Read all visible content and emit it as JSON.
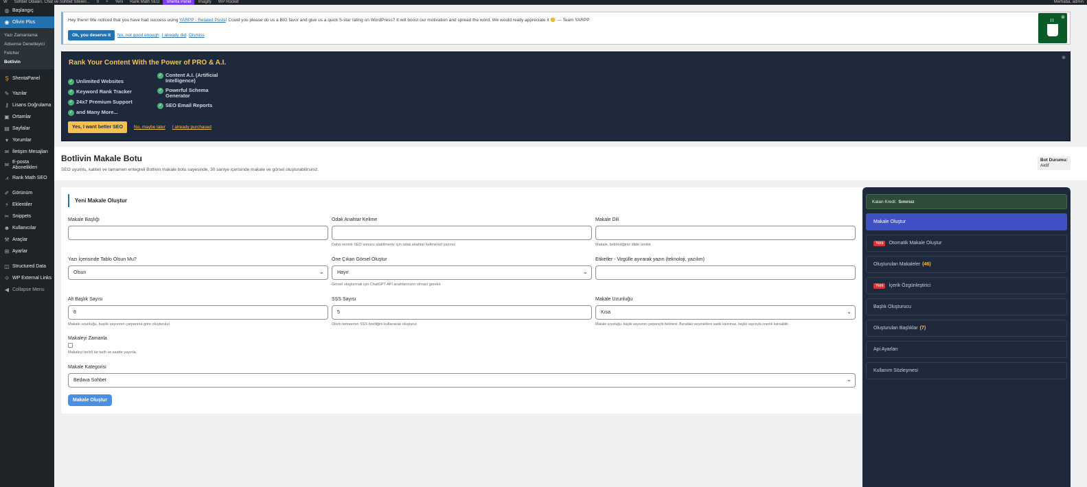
{
  "adminbar": {
    "items": [
      "W",
      "Sohbet Odaları, Chat ve Sohbet Siteleri...",
      "0",
      "+",
      "Yeni",
      "Rank Math SEO",
      "Shenta Panel",
      "Imagify",
      "WP Rocket"
    ],
    "active_index": 6,
    "user": "Merhaba, admin"
  },
  "sidebar": {
    "dashboard": "Başlangıç",
    "current": "Olivin Plus",
    "submenu": [
      "Yazı Zamanlama",
      "Adsense Denetleyici",
      "Fetcher",
      "Botlivin"
    ],
    "submenu_active": "Botlivin",
    "shenta": "ShentaPanel",
    "items": [
      "Yazılar",
      "Lisans Doğrulama",
      "Ortamlar",
      "Sayfalar",
      "Yorumlar",
      "İletişim Mesajları",
      "E-posta Abonelikleri",
      "Rank Math SEO"
    ],
    "items2": [
      "Görünüm",
      "Eklentiler",
      "Snippets",
      "Kullanıcılar",
      "Araçlar",
      "Ayarlar"
    ],
    "items3": [
      "Structured Data",
      "WP External Links"
    ],
    "collapse": "Collapse Menu"
  },
  "yarpp_notice": {
    "text_before": "Hey there! We noticed that you have had success using ",
    "link": "YARPP - Related Posts",
    "text_after": "! Could you please do us a BIG favor and give us a quick 5-star rating on WordPress? It will boost our motivation and spread the word. We would really appreciate it 🙂 — Team YARPP",
    "btn": "Ok, you deserve it",
    "links": [
      "No, not good enough",
      "I already did",
      "Dismiss"
    ]
  },
  "rankmath_notice": {
    "title": "Rank Your Content With the Power of PRO & A.I.",
    "col1": [
      "Unlimited Websites",
      "Keyword Rank Tracker",
      "24x7 Premium Support",
      "and Many More..."
    ],
    "col2": [
      "Content A.I. (Artificial Intelligence)",
      "Powerful Schema Generator",
      "SEO Email Reports"
    ],
    "btn": "Yes, I want better SEO",
    "links": [
      "No, maybe later",
      "I already purchased"
    ]
  },
  "page": {
    "title": "Botlivin Makale Botu",
    "subtitle": "SEO uyumlu, kaliteli ve tamamen entegreli Botlivin makale botu sayesinde, 30 saniye içerisinde makale ve görsel oluşturabilirsiniz.",
    "status_label": "Bot Durumu:",
    "status_value": "Aktif"
  },
  "form": {
    "title": "Yeni Makale Oluştur",
    "f_title": {
      "label": "Makale Başlığı",
      "value": ""
    },
    "f_keyword": {
      "label": "Odak Anahtar Kelime",
      "value": "",
      "hint": "Daha verimli SEO sonucu alabilmeniz için odak anahtar kelimenizi yazınız."
    },
    "f_lang": {
      "label": "Makale Dili",
      "value": "",
      "hint": "Makale, belirlediğiniz dilde üretilir."
    },
    "f_table": {
      "label": "Yazı İçerisinde Tablo Olsun Mu?",
      "value": "Olsun"
    },
    "f_image": {
      "label": "Öne Çıkan Görsel Oluştur",
      "value": "Hayır",
      "hint": "Görsel oluşturmak için ChatGPT API anahtarınızın olması gerekir."
    },
    "f_tags": {
      "label": "Etiketler - Virgülle ayırarak yazın (teknoloji, yazılım)",
      "value": ""
    },
    "f_subheads": {
      "label": "Alt Başlık Sayısı",
      "value": "8",
      "hint": "Makale uzunluğu, başlık sayısının çarpanına göre oluşturulur."
    },
    "f_faq": {
      "label": "SSS Sayısı",
      "value": "5",
      "hint": "Olivin temasının SSS özelliğini kullanarak oluşturur."
    },
    "f_length": {
      "label": "Makale Uzunluğu",
      "value": "Kısa",
      "hint": "Makale uzunluğu, başlık sayısının çarpanıyla belirlenir. Buradaki seçeneklere sadık kalınmaz, başlık sayısıyla orantılı kalınabilir."
    },
    "f_schedule": {
      "label": "Makaleyi Zamanla",
      "hint": "Makaleyi belirli bir tarih ve saatte yayınla.",
      "checked": false
    },
    "f_category": {
      "label": "Makale Kategorisi",
      "value": "Bedava Sohbet"
    },
    "submit": "Makale Oluştur"
  },
  "rpanel": {
    "credit_label": "Kalan Kredi:",
    "credit_value": "Sınırsız",
    "items": [
      {
        "label": "Makale Oluştur",
        "active": true
      },
      {
        "label": "Otomatik Makale Oluştur",
        "badge": "Yeni"
      },
      {
        "label": "Oluşturulan Makaleler",
        "count": "(46)"
      },
      {
        "label": "İçerik Özgünleştirici",
        "badge": "Yeni"
      },
      {
        "label": "Başlık Oluşturucu"
      },
      {
        "label": "Oluşturulan Başlıklar",
        "count": "(7)"
      },
      {
        "label": "Api Ayarları"
      },
      {
        "label": "Kullanım Sözleşmesi"
      }
    ]
  },
  "colors": {
    "accent": "#2271b1",
    "panel": "#1e2a3b",
    "active_item": "#3f51c4",
    "highlight": "#f5c252",
    "new_badge": "#d63638"
  }
}
